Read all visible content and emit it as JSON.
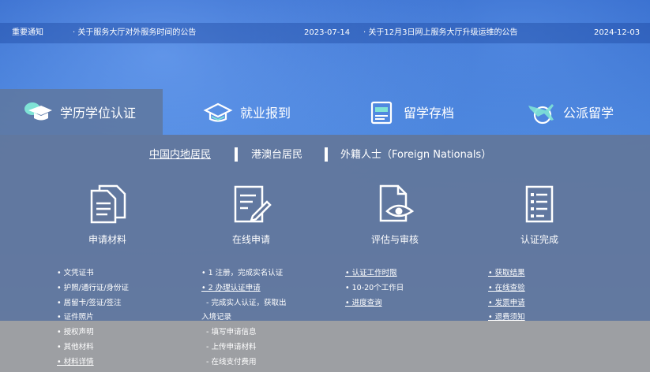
{
  "notice": {
    "label": "重要通知",
    "items": [
      {
        "title": "· 关于服务大厅对外服务时间的公告",
        "date": "2023-07-14"
      },
      {
        "title": "· 关于12月3日网上服务大厅升级运维的公告",
        "date": "2024-12-03"
      }
    ]
  },
  "tabs": [
    {
      "label": "学历学位认证",
      "icon": "graduation-cap-icon",
      "active": true
    },
    {
      "label": "就业报到",
      "icon": "briefcase-icon",
      "active": false
    },
    {
      "label": "留学存档",
      "icon": "id-card-icon",
      "active": false
    },
    {
      "label": "公派留学",
      "icon": "airplane-icon",
      "active": false
    }
  ],
  "residency": [
    "中国内地居民",
    "港澳台居民",
    "外籍人士（Foreign Nationals）"
  ],
  "steps": [
    {
      "label": "申请材料",
      "icon": "documents-icon"
    },
    {
      "label": "在线申请",
      "icon": "edit-form-icon"
    },
    {
      "label": "评估与审核",
      "icon": "document-eye-icon"
    },
    {
      "label": "认证完成",
      "icon": "checklist-icon"
    }
  ],
  "lists": {
    "materials": [
      "• 文凭证书",
      "• 护照/通行证/身份证",
      "• 居留卡/签证/签注",
      "• 证件照片",
      "• 授权声明",
      "• 其他材料",
      "• 材料详情"
    ],
    "apply": [
      "• 1 注册，完成实名认证",
      "• 2 办理认证申请",
      "- 完成实人认证，获取出",
      "入境记录",
      "- 填写申请信息",
      "- 上传申请材料",
      "- 在线支付费用"
    ],
    "review": [
      "• 认证工作时限",
      "• 10-20个工作日",
      "• 进度查询"
    ],
    "done": [
      "• 获取结果",
      "• 在线查验",
      "• 发票申请",
      "• 退费须知"
    ]
  },
  "colors": {
    "active_tab": "#5f78a0",
    "panel": "#62769b",
    "accent": "#2d63c6"
  }
}
